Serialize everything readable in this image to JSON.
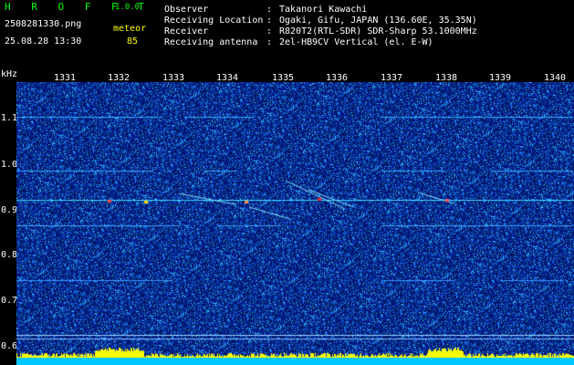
{
  "header": {
    "app_name": "H R O F F T",
    "version": "1.0.0",
    "filename": "2508281330.png",
    "datetime": "25.08.28 13:30",
    "meteor_label": "meteor",
    "meteor_count": "85",
    "separator": ":",
    "info": [
      {
        "label": "Observer",
        "value": "Takanori Kawachi"
      },
      {
        "label": "Receiving Location",
        "value": "Ogaki, Gifu, JAPAN (136.60E, 35.35N)"
      },
      {
        "label": "Receiver",
        "value": "R820T2(RTL-SDR) SDR-Sharp 53.1000MHz"
      },
      {
        "label": "Receiving antenna",
        "value": "2el-HB9CV Vertical (el. E-W)"
      }
    ]
  },
  "axis": {
    "y_unit": "kHz",
    "y_ticks": [
      "1.1",
      "1.0",
      "0.9",
      "0.8",
      "0.7",
      "0.6"
    ],
    "x_ticks": [
      "1331",
      "1332",
      "1333",
      "1334",
      "1335",
      "1336",
      "1337",
      "1338",
      "1339",
      "1340"
    ]
  },
  "colors": {
    "background": "#000000",
    "waterfall_base": "#00187a",
    "header_text": "#ffffff",
    "logo": "#00ff00",
    "meteor": "#ffff00",
    "signal_line": "#00e0ff",
    "level_bar": "#ffff00",
    "level_base": "#00c8ff"
  }
}
